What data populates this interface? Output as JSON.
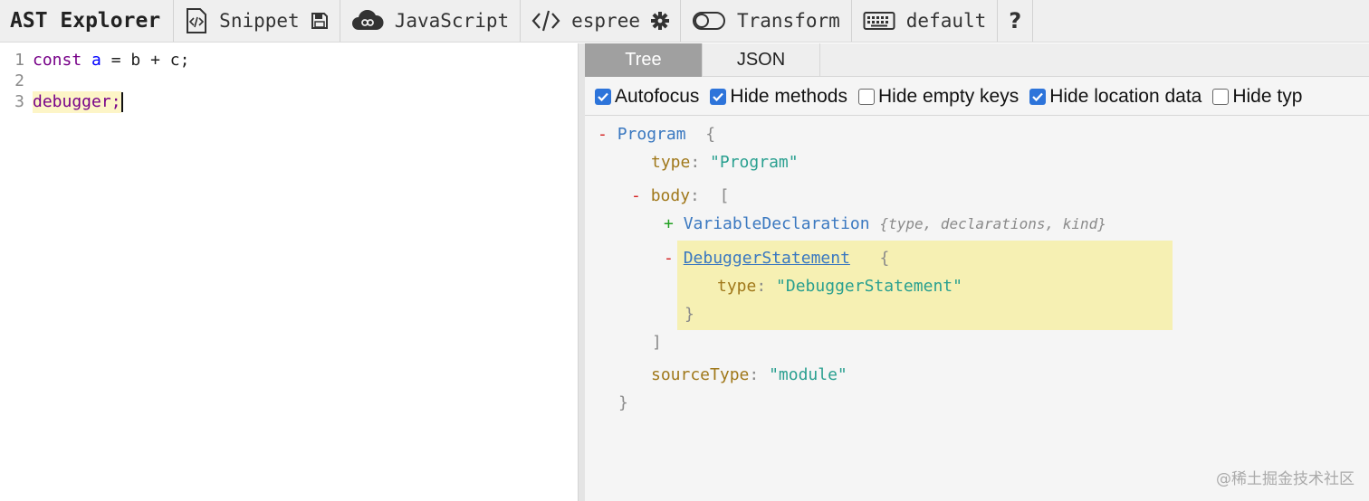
{
  "toolbar": {
    "title": "AST Explorer",
    "snippet_label": "Snippet",
    "language_label": "JavaScript",
    "parser_label": "espree",
    "transform_label": "Transform",
    "keymap_label": "default",
    "help_label": "?"
  },
  "editor": {
    "lines": [
      {
        "number": "1",
        "tokens": {
          "kw": "const",
          "var": "a",
          "rest": "= b + c;"
        }
      },
      {
        "number": "2"
      },
      {
        "number": "3",
        "text": "debugger;"
      }
    ]
  },
  "panel": {
    "tabs": [
      {
        "label": "Tree",
        "active": true
      },
      {
        "label": "JSON",
        "active": false
      }
    ],
    "options": [
      {
        "label": "Autofocus",
        "checked": true
      },
      {
        "label": "Hide methods",
        "checked": true
      },
      {
        "label": "Hide empty keys",
        "checked": false
      },
      {
        "label": "Hide location data",
        "checked": true
      },
      {
        "label": "Hide typ",
        "checked": false
      }
    ]
  },
  "tree": {
    "root_name": "Program",
    "type_key": "type",
    "root_type_value": "\"Program\"",
    "body_key": "body",
    "var_decl_name": "VariableDeclaration",
    "var_decl_summary": "{type, declarations, kind}",
    "dbg_name": "DebuggerStatement",
    "dbg_type_value": "\"DebuggerStatement\"",
    "source_type_key": "sourceType",
    "source_type_value": "\"module\""
  },
  "watermark": "@稀土掘金技术社区",
  "colors": {
    "checkbox_on": "#2d74da",
    "node_name": "#3a78c0",
    "property": "#a0781a",
    "string": "#2aa090",
    "highlight": "#f6f0b3"
  }
}
